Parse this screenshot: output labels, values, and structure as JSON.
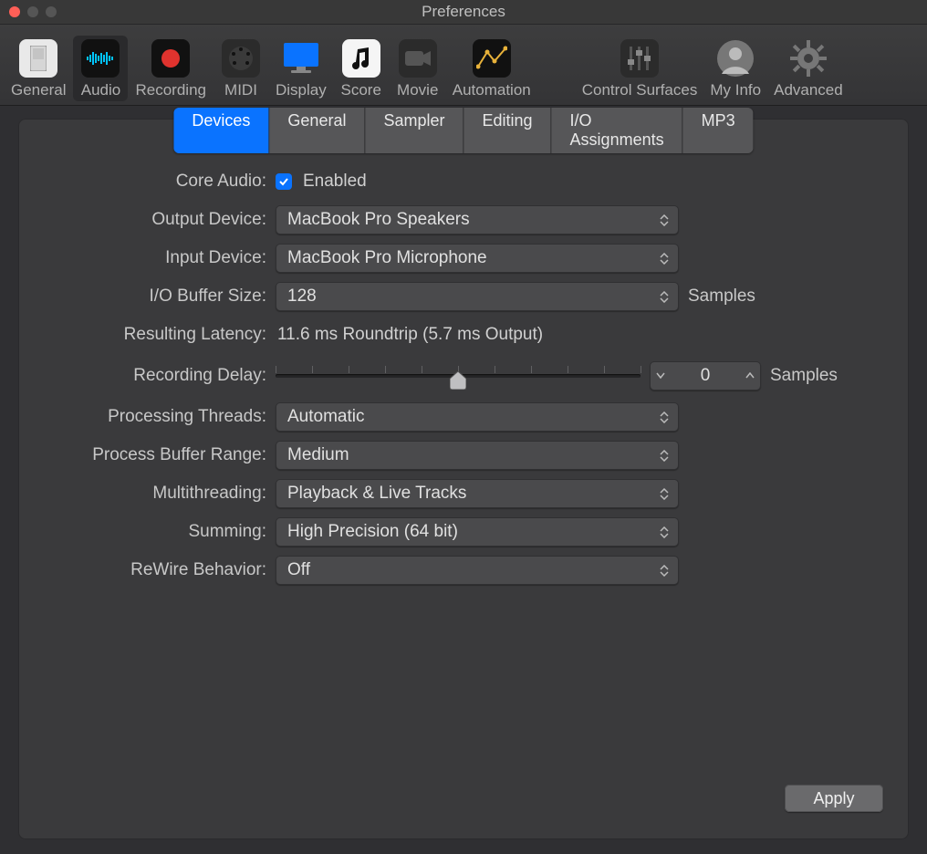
{
  "window": {
    "title": "Preferences"
  },
  "toolbar": {
    "items": [
      {
        "label": "General"
      },
      {
        "label": "Audio"
      },
      {
        "label": "Recording"
      },
      {
        "label": "MIDI"
      },
      {
        "label": "Display"
      },
      {
        "label": "Score"
      },
      {
        "label": "Movie"
      },
      {
        "label": "Automation"
      },
      {
        "label": "Control Surfaces"
      },
      {
        "label": "My Info"
      },
      {
        "label": "Advanced"
      }
    ],
    "selected": "Audio"
  },
  "tabs": {
    "items": [
      "Devices",
      "General",
      "Sampler",
      "Editing",
      "I/O Assignments",
      "MP3"
    ],
    "active": "Devices"
  },
  "form": {
    "core_audio": {
      "label": "Core Audio:",
      "checkbox_label": "Enabled",
      "checked": true
    },
    "output_device": {
      "label": "Output Device:",
      "value": "MacBook Pro Speakers"
    },
    "input_device": {
      "label": "Input Device:",
      "value": "MacBook Pro Microphone"
    },
    "io_buffer": {
      "label": "I/O Buffer Size:",
      "value": "128",
      "unit": "Samples"
    },
    "latency": {
      "label": "Resulting Latency:",
      "value": "11.6 ms Roundtrip (5.7 ms Output)"
    },
    "recording_delay": {
      "label": "Recording Delay:",
      "value": "0",
      "unit": "Samples",
      "slider_position": 0.5,
      "ticks": 11
    },
    "processing_threads": {
      "label": "Processing Threads:",
      "value": "Automatic"
    },
    "process_buffer_range": {
      "label": "Process Buffer Range:",
      "value": "Medium"
    },
    "multithreading": {
      "label": "Multithreading:",
      "value": "Playback & Live Tracks"
    },
    "summing": {
      "label": "Summing:",
      "value": "High Precision (64 bit)"
    },
    "rewire": {
      "label": "ReWire Behavior:",
      "value": "Off"
    }
  },
  "apply_button": "Apply"
}
